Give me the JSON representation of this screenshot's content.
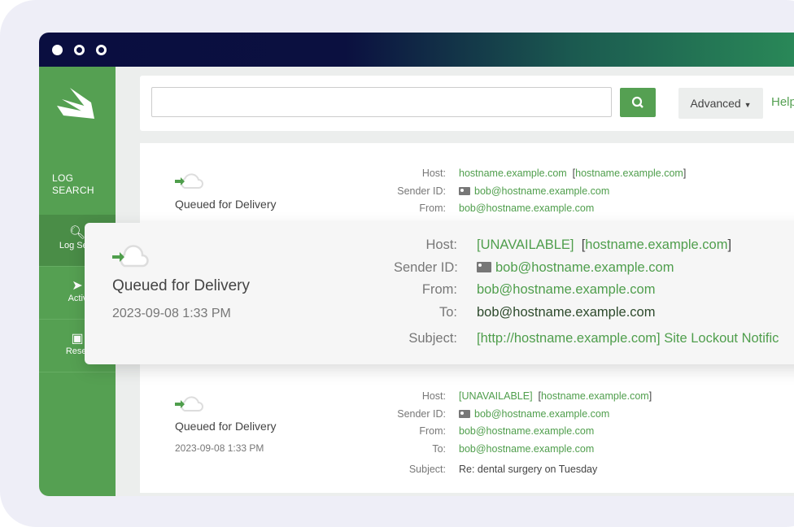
{
  "colors": {
    "brand_green": "#55a052",
    "titlebar": "#0a0e40"
  },
  "sidebar": {
    "title": "LOG SEARCH",
    "items": [
      {
        "label": "Log Search",
        "icon": "search-icon",
        "active": true
      },
      {
        "label": "Activity",
        "icon": "paper-plane-icon"
      },
      {
        "label": "Reseller",
        "icon": "briefcase-icon"
      }
    ]
  },
  "search": {
    "value": "",
    "advanced_label": "Advanced",
    "help_label": "Help"
  },
  "labels": {
    "host": "Host:",
    "sender": "Sender ID:",
    "from": "From:",
    "to": "To:",
    "subject": "Subject:"
  },
  "entries": [
    {
      "status": "Queued for Delivery",
      "host": "hostname.example.com",
      "host_bracket": "hostname.example.com",
      "sender": "bob@hostname.example.com",
      "from": "bob@hostname.example.com"
    },
    {
      "status": "Queued for Delivery",
      "date": "2023-09-08 1:33 PM",
      "host": "[UNAVAILABLE]",
      "host_bracket": "hostname.example.com",
      "sender": "bob@hostname.example.com",
      "from": "bob@hostname.example.com",
      "to": "bob@hostname.example.com",
      "subject": "[http://hostname.example.com] Site Lockout Notific"
    },
    {
      "status": "Queued for Delivery",
      "date": "2023-09-08 1:33 PM",
      "host": "[UNAVAILABLE]",
      "host_bracket": "hostname.example.com",
      "sender": "bob@hostname.example.com",
      "from": "bob@hostname.example.com",
      "to": "bob@hostname.example.com",
      "subject": "Re: dental surgery on Tuesday"
    }
  ]
}
